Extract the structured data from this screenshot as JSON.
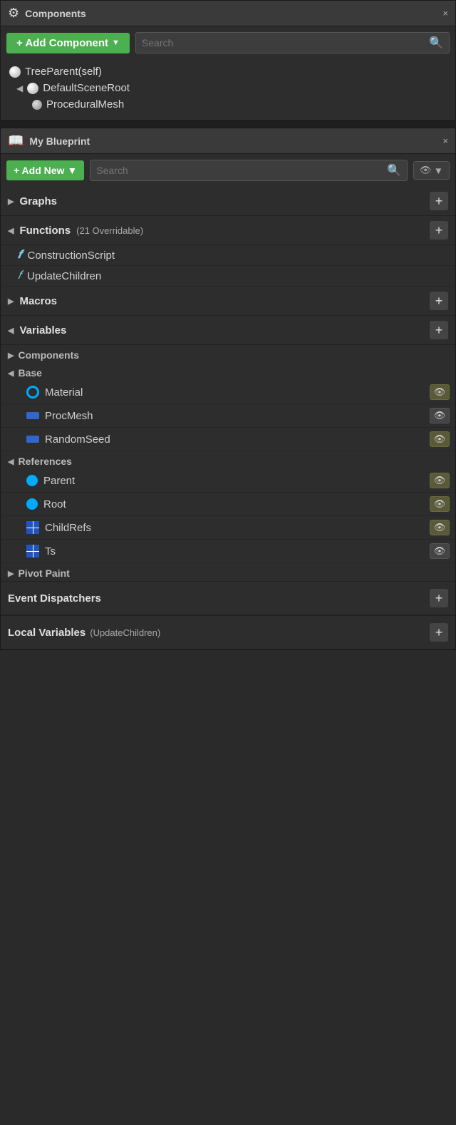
{
  "components_panel": {
    "title": "Components",
    "search_placeholder": "Search",
    "add_component_label": "+ Add Component",
    "tree": [
      {
        "id": "tree-parent",
        "label": "TreeParent(self)",
        "indent": 0,
        "icon": "sphere",
        "arrow": false
      },
      {
        "id": "default-scene-root",
        "label": "DefaultSceneRoot",
        "indent": 1,
        "icon": "sphere",
        "arrow": true
      },
      {
        "id": "procedural-mesh",
        "label": "ProceduralMesh",
        "indent": 2,
        "icon": "sphere-small",
        "arrow": false
      }
    ]
  },
  "my_blueprint_panel": {
    "title": "My Blueprint",
    "add_new_label": "+ Add New",
    "search_placeholder": "Search",
    "sections": {
      "graphs": {
        "label": "Graphs",
        "expanded": false
      },
      "functions": {
        "label": "Functions",
        "badge": "(21 Overridable)",
        "expanded": true,
        "items": [
          {
            "id": "construction-script",
            "label": "ConstructionScript",
            "icon": "construction"
          },
          {
            "id": "update-children",
            "label": "UpdateChildren",
            "icon": "f"
          }
        ]
      },
      "macros": {
        "label": "Macros",
        "expanded": false
      },
      "variables": {
        "label": "Variables",
        "expanded": true,
        "sub_sections": [
          {
            "label": "Components",
            "expanded": false,
            "items": []
          },
          {
            "label": "Base",
            "expanded": true,
            "items": [
              {
                "id": "material",
                "label": "Material",
                "icon": "circle-outline",
                "visible": true
              },
              {
                "id": "proc-mesh",
                "label": "ProcMesh",
                "icon": "rect-blue",
                "visible": false
              },
              {
                "id": "random-seed",
                "label": "RandomSeed",
                "icon": "rect-blue",
                "visible": true
              }
            ]
          },
          {
            "label": "References",
            "expanded": true,
            "items": [
              {
                "id": "parent",
                "label": "Parent",
                "icon": "circle-solid-blue",
                "visible": true
              },
              {
                "id": "root",
                "label": "Root",
                "icon": "circle-solid-blue",
                "visible": true
              },
              {
                "id": "childrefs",
                "label": "ChildRefs",
                "icon": "grid-blue",
                "visible": true
              },
              {
                "id": "ts",
                "label": "Ts",
                "icon": "grid-blue",
                "visible": false
              }
            ]
          },
          {
            "label": "Pivot Paint",
            "expanded": false,
            "items": []
          }
        ]
      }
    },
    "bottom_sections": [
      {
        "label": "Event Dispatchers",
        "add": true
      },
      {
        "label": "Local Variables",
        "sub_label": "(UpdateChildren)",
        "add": true
      }
    ]
  },
  "icons": {
    "plus": "+",
    "arrow_down": "▼",
    "arrow_right": "▶",
    "arrow_down_filled": "◀",
    "close": "×",
    "search": "🔍",
    "eye": "👁",
    "add": "+"
  }
}
